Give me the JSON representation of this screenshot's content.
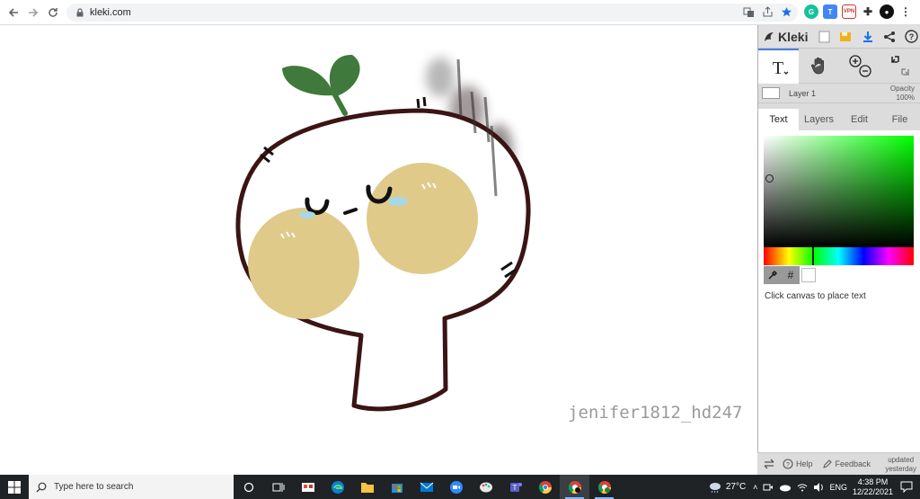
{
  "browser": {
    "url": "kleki.com"
  },
  "canvas": {
    "watermark": "jenifer1812_hd247"
  },
  "kleki": {
    "logo_text": "Kleki",
    "layer_name": "Layer 1",
    "opacity_label": "Opacity",
    "opacity_value": "100%",
    "tabs": [
      {
        "label": "Text"
      },
      {
        "label": "Layers"
      },
      {
        "label": "Edit"
      },
      {
        "label": "File"
      }
    ],
    "hex_label": "#",
    "status": "Click canvas to place text",
    "bottom": {
      "help_label": "Help",
      "feedback_label": "Feedback",
      "updated_line1": "updated",
      "updated_line2": "yesterday"
    }
  },
  "taskbar": {
    "search_placeholder": "Type here to search",
    "temperature": "27°C",
    "language": "ENG",
    "time": "4:38 PM",
    "date": "12/22/2021"
  }
}
